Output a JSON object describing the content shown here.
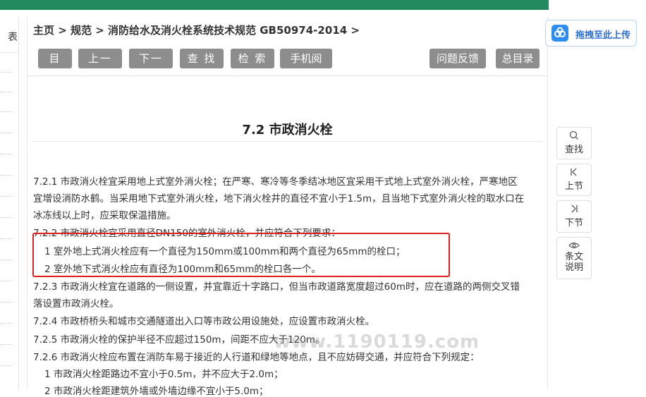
{
  "breadcrumb": "主页 > 规范 > 消防给水及消火栓系统技术规范 GB50974-2014 >",
  "left_panel": {
    "tab_char": "表"
  },
  "toolbar": {
    "left": [
      "目 录",
      "上一节",
      "下一节",
      "查 找",
      "检 索",
      "手机阅读"
    ],
    "right": [
      "问题反馈",
      "总目录"
    ]
  },
  "section_title": "7.2 市政消火栓",
  "lines": [
    "7.2.1 市政消火栓宜采用地上式室外消火栓；在严寒、寒冷等冬季结冰地区宜采用干式地上式室外消火栓，严寒地区",
    "宜增设消防水鹤。当采用地下式室外消火栓，地下消火栓井的直径不宜小于1.5m，且当地下式室外消火栓的取水口在",
    "冰冻线以上时，应采取保温措施。",
    "7.2.2 市政消火栓宜采用直径DN150的室外消火栓，并应符合下列要求：",
    "1 室外地上式消火栓应有一个直径为150mm或100mm和两个直径为65mm的栓口；",
    "2 室外地下式消火栓应有直径为100mm和65mm的栓口各一个。",
    "7.2.3 市政消火栓宜在道路的一侧设置，并宜靠近十字路口，但当市政道路宽度超过60m时，应在道路的两侧交叉错",
    "落设置市政消火栓。",
    "7.2.4 市政桥桥头和城市交通隧道出入口等市政公用设施处，应设置市政消火栓。",
    "7.2.5 市政消火栓的保护半径不应超过150m，间距不应大于120m。",
    "7.2.6 市政消火栓应布置在消防车易于接近的人行道和绿地等地点，且不应妨碍交通，并应符合下列规定：",
    "1 市政消火栓距路边不宜小于0.5m，并不应大于2.0m；",
    "2 市政消火栓距建筑外墙或外墙边缘不宜小于5.0m；"
  ],
  "watermark": "www.1190119.com",
  "upload_button": {
    "label": "拖拽至此上传",
    "icon": "cloud-upload-icon"
  },
  "side_buttons": [
    {
      "label": "查找",
      "icon": "search-icon"
    },
    {
      "label": "上节",
      "icon": "prev-section-icon"
    },
    {
      "label": "下节",
      "icon": "next-section-icon"
    },
    {
      "label": "条文说明",
      "icon": "eye-icon"
    }
  ],
  "colors": {
    "top_bar": "#23895f",
    "toolbar_button": "#8d8d8d",
    "highlight": "#e02020",
    "upload_accent": "#2f8cf0"
  }
}
